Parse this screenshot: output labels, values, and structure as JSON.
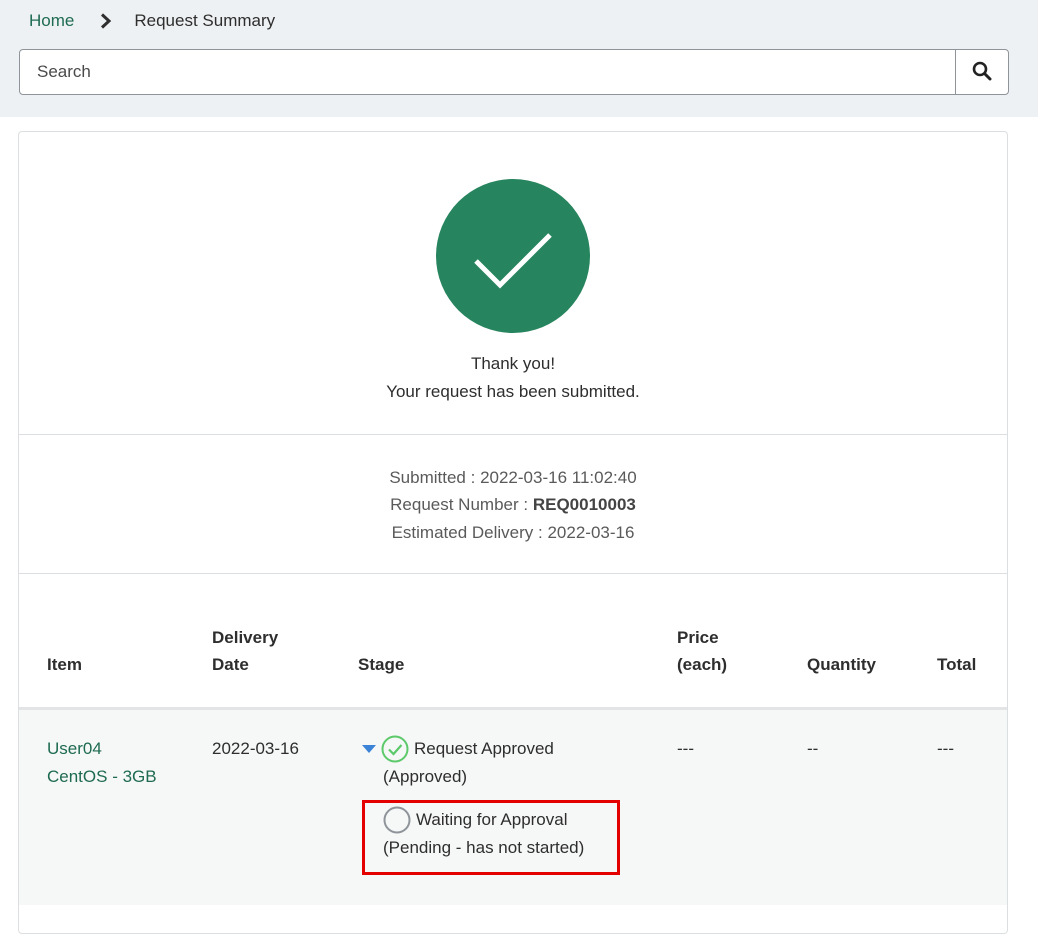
{
  "breadcrumb": {
    "home": "Home",
    "current": "Request Summary"
  },
  "search": {
    "placeholder": "Search",
    "value": ""
  },
  "confirmation": {
    "line1": "Thank you!",
    "line2": "Your request has been submitted."
  },
  "details": {
    "submitted_label": "Submitted :",
    "submitted_value": "2022-03-16 11:02:40",
    "request_number_label": "Request Number :",
    "request_number_value": "REQ0010003",
    "estimated_delivery_label": "Estimated Delivery :",
    "estimated_delivery_value": "2022-03-16"
  },
  "table": {
    "headers": {
      "item": "Item",
      "delivery_date_1": "Delivery",
      "delivery_date_2": "Date",
      "stage": "Stage",
      "price_1": "Price",
      "price_2": "(each)",
      "quantity": "Quantity",
      "total": "Total"
    },
    "row": {
      "item_line1": "User04",
      "item_line2": "CentOS - 3GB",
      "delivery_date": "2022-03-16",
      "stage1_label": "Request Approved",
      "stage1_status": "(Approved)",
      "stage2_label": "Waiting for Approval",
      "stage2_status": "(Pending - has not started)",
      "price": "---",
      "quantity": "--",
      "total": "---"
    }
  },
  "colors": {
    "success": "#26845e",
    "link": "#1e6b52",
    "approved_icon": "#5cc96a",
    "pending_icon": "#8e9499",
    "highlight": "#e50000"
  },
  "icons": {
    "breadcrumb_separator": "chevron-right-icon",
    "search": "search-icon",
    "success": "checkmark-icon",
    "expand": "caret-down-icon",
    "approved": "check-circle-icon",
    "pending": "empty-circle-icon"
  }
}
